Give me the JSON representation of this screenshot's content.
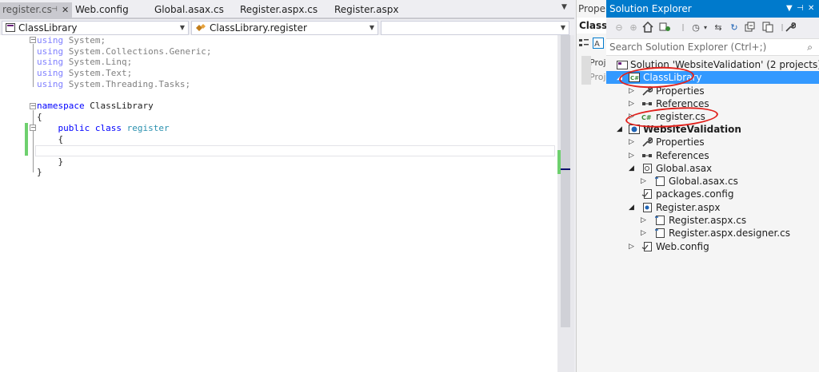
{
  "colors": {
    "accent": "#007acc",
    "selection": "#3399ff",
    "keyword": "#0000ff",
    "type": "#2b91af",
    "change_bar": "#6ed06e",
    "annotation_red": "#e0201b"
  },
  "editor_tabs": [
    {
      "label": "register.cs",
      "active": true,
      "pinned": true
    },
    {
      "label": "Web.config"
    },
    {
      "label": "Global.asax.cs"
    },
    {
      "label": "Register.aspx.cs"
    },
    {
      "label": "Register.aspx"
    }
  ],
  "navbar": {
    "project_combo": "ClassLibrary",
    "type_combo": "ClassLibrary.register",
    "member_combo": ""
  },
  "code": {
    "using1_kw": "using",
    "using1_ns": " System;",
    "using2_kw": "using",
    "using2_ns": " System.Collections.Generic;",
    "using3_kw": "using",
    "using3_ns": " System.Linq;",
    "using4_kw": "using",
    "using4_ns": " System.Text;",
    "using5_kw": "using",
    "using5_ns": " System.Threading.Tasks;",
    "ns_kw": "namespace",
    "ns_name": " ClassLibrary",
    "brace_open": "{",
    "class_mod": "    public class ",
    "class_name": "register",
    "class_brace_open": "    {",
    "class_brace_close": "    }",
    "brace_close": "}"
  },
  "properties_panel": {
    "title": "Proper",
    "object": "ClassLi",
    "row1": "Proj",
    "row2": "Proj"
  },
  "solution_explorer": {
    "title": "Solution Explorer",
    "pin": "▾ ⊣ ✕",
    "search_placeholder": "Search Solution Explorer (Ctrl+;)",
    "tree": {
      "solution": "Solution 'WebsiteValidation' (2 projects)",
      "classlibrary": "ClassLibrary",
      "cl_properties": "Properties",
      "cl_references": "References",
      "cl_register": "register.cs",
      "website": "WebsiteValidation",
      "ws_properties": "Properties",
      "ws_references": "References",
      "global_asax": "Global.asax",
      "global_asax_cs": "Global.asax.cs",
      "packages_config": "packages.config",
      "register_aspx": "Register.aspx",
      "register_aspx_cs": "Register.aspx.cs",
      "register_designer": "Register.aspx.designer.cs",
      "web_config": "Web.config"
    }
  }
}
